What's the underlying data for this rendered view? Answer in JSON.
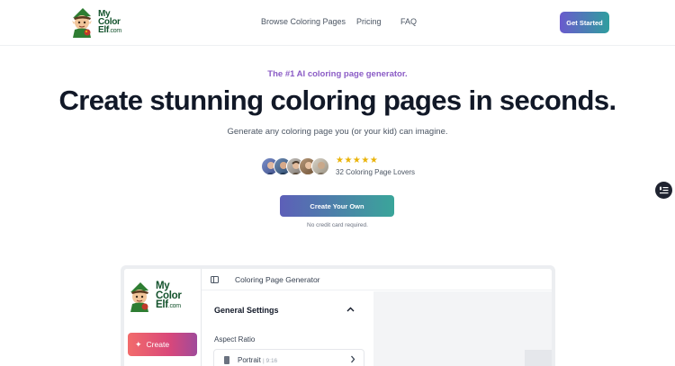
{
  "header": {
    "logo_text_line1": "My",
    "logo_text_line2": "Color",
    "logo_text_line3": "Elf",
    "logo_text_suffix": ".com",
    "nav": [
      {
        "label": "Browse Coloring Pages"
      },
      {
        "label": "Pricing"
      },
      {
        "label": "FAQ"
      }
    ],
    "cta_label": "Get Started"
  },
  "hero": {
    "tagline": "The #1 AI coloring page generator.",
    "headline": "Create stunning coloring pages in seconds.",
    "subhead": "Generate any coloring page you (or your kid) can imagine.",
    "rating_stars": 5,
    "stars_text": "★★★★★",
    "rating_label": "32 Coloring Page Lovers",
    "cta_label": "Create Your Own",
    "cta_note": "No credit card required."
  },
  "preview": {
    "sidebar_create_label": "Create",
    "topbar_title": "Coloring Page Generator",
    "settings_title": "General Settings",
    "aspect_label": "Aspect Ratio",
    "aspect_value": "Portrait",
    "aspect_ratio": "| 9:16"
  },
  "colors": {
    "accent_purple": "#8b5cc6",
    "cta_gradient_start": "#5d5fb8",
    "cta_gradient_end": "#3aa59a",
    "star": "#eab308",
    "create_gradient_start": "#f26b6b",
    "create_gradient_end": "#a04a9a"
  }
}
